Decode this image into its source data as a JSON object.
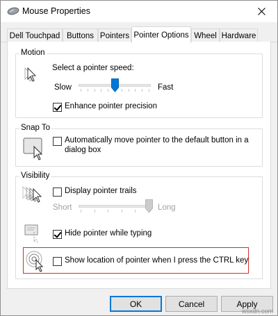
{
  "window": {
    "title": "Mouse Properties"
  },
  "tabs": [
    {
      "label": "Dell Touchpad"
    },
    {
      "label": "Buttons"
    },
    {
      "label": "Pointers"
    },
    {
      "label": "Pointer Options",
      "active": true
    },
    {
      "label": "Wheel"
    },
    {
      "label": "Hardware"
    }
  ],
  "motion": {
    "group_label": "Motion",
    "speed_label": "Select a pointer speed:",
    "slow_label": "Slow",
    "fast_label": "Fast",
    "speed_fraction": 0.5,
    "precision_label": "Enhance pointer precision",
    "precision_checked": true
  },
  "snap_to": {
    "group_label": "Snap To",
    "option_line1": "Automatically move pointer to the default button in a",
    "option_line2": "dialog box",
    "checked": false
  },
  "visibility": {
    "group_label": "Visibility",
    "trails_label": "Display pointer trails",
    "trails_checked": false,
    "short_label": "Short",
    "long_label": "Long",
    "trails_fraction": 1.0,
    "hide_label": "Hide pointer while typing",
    "hide_checked": true,
    "ctrl_label": "Show location of pointer when I press the CTRL key",
    "ctrl_checked": false
  },
  "buttons": {
    "ok": "OK",
    "cancel": "Cancel",
    "apply": "Apply"
  },
  "watermark": "wsxdn.com",
  "colors": {
    "accent": "#0078d7",
    "highlight": "#d52b2b"
  }
}
